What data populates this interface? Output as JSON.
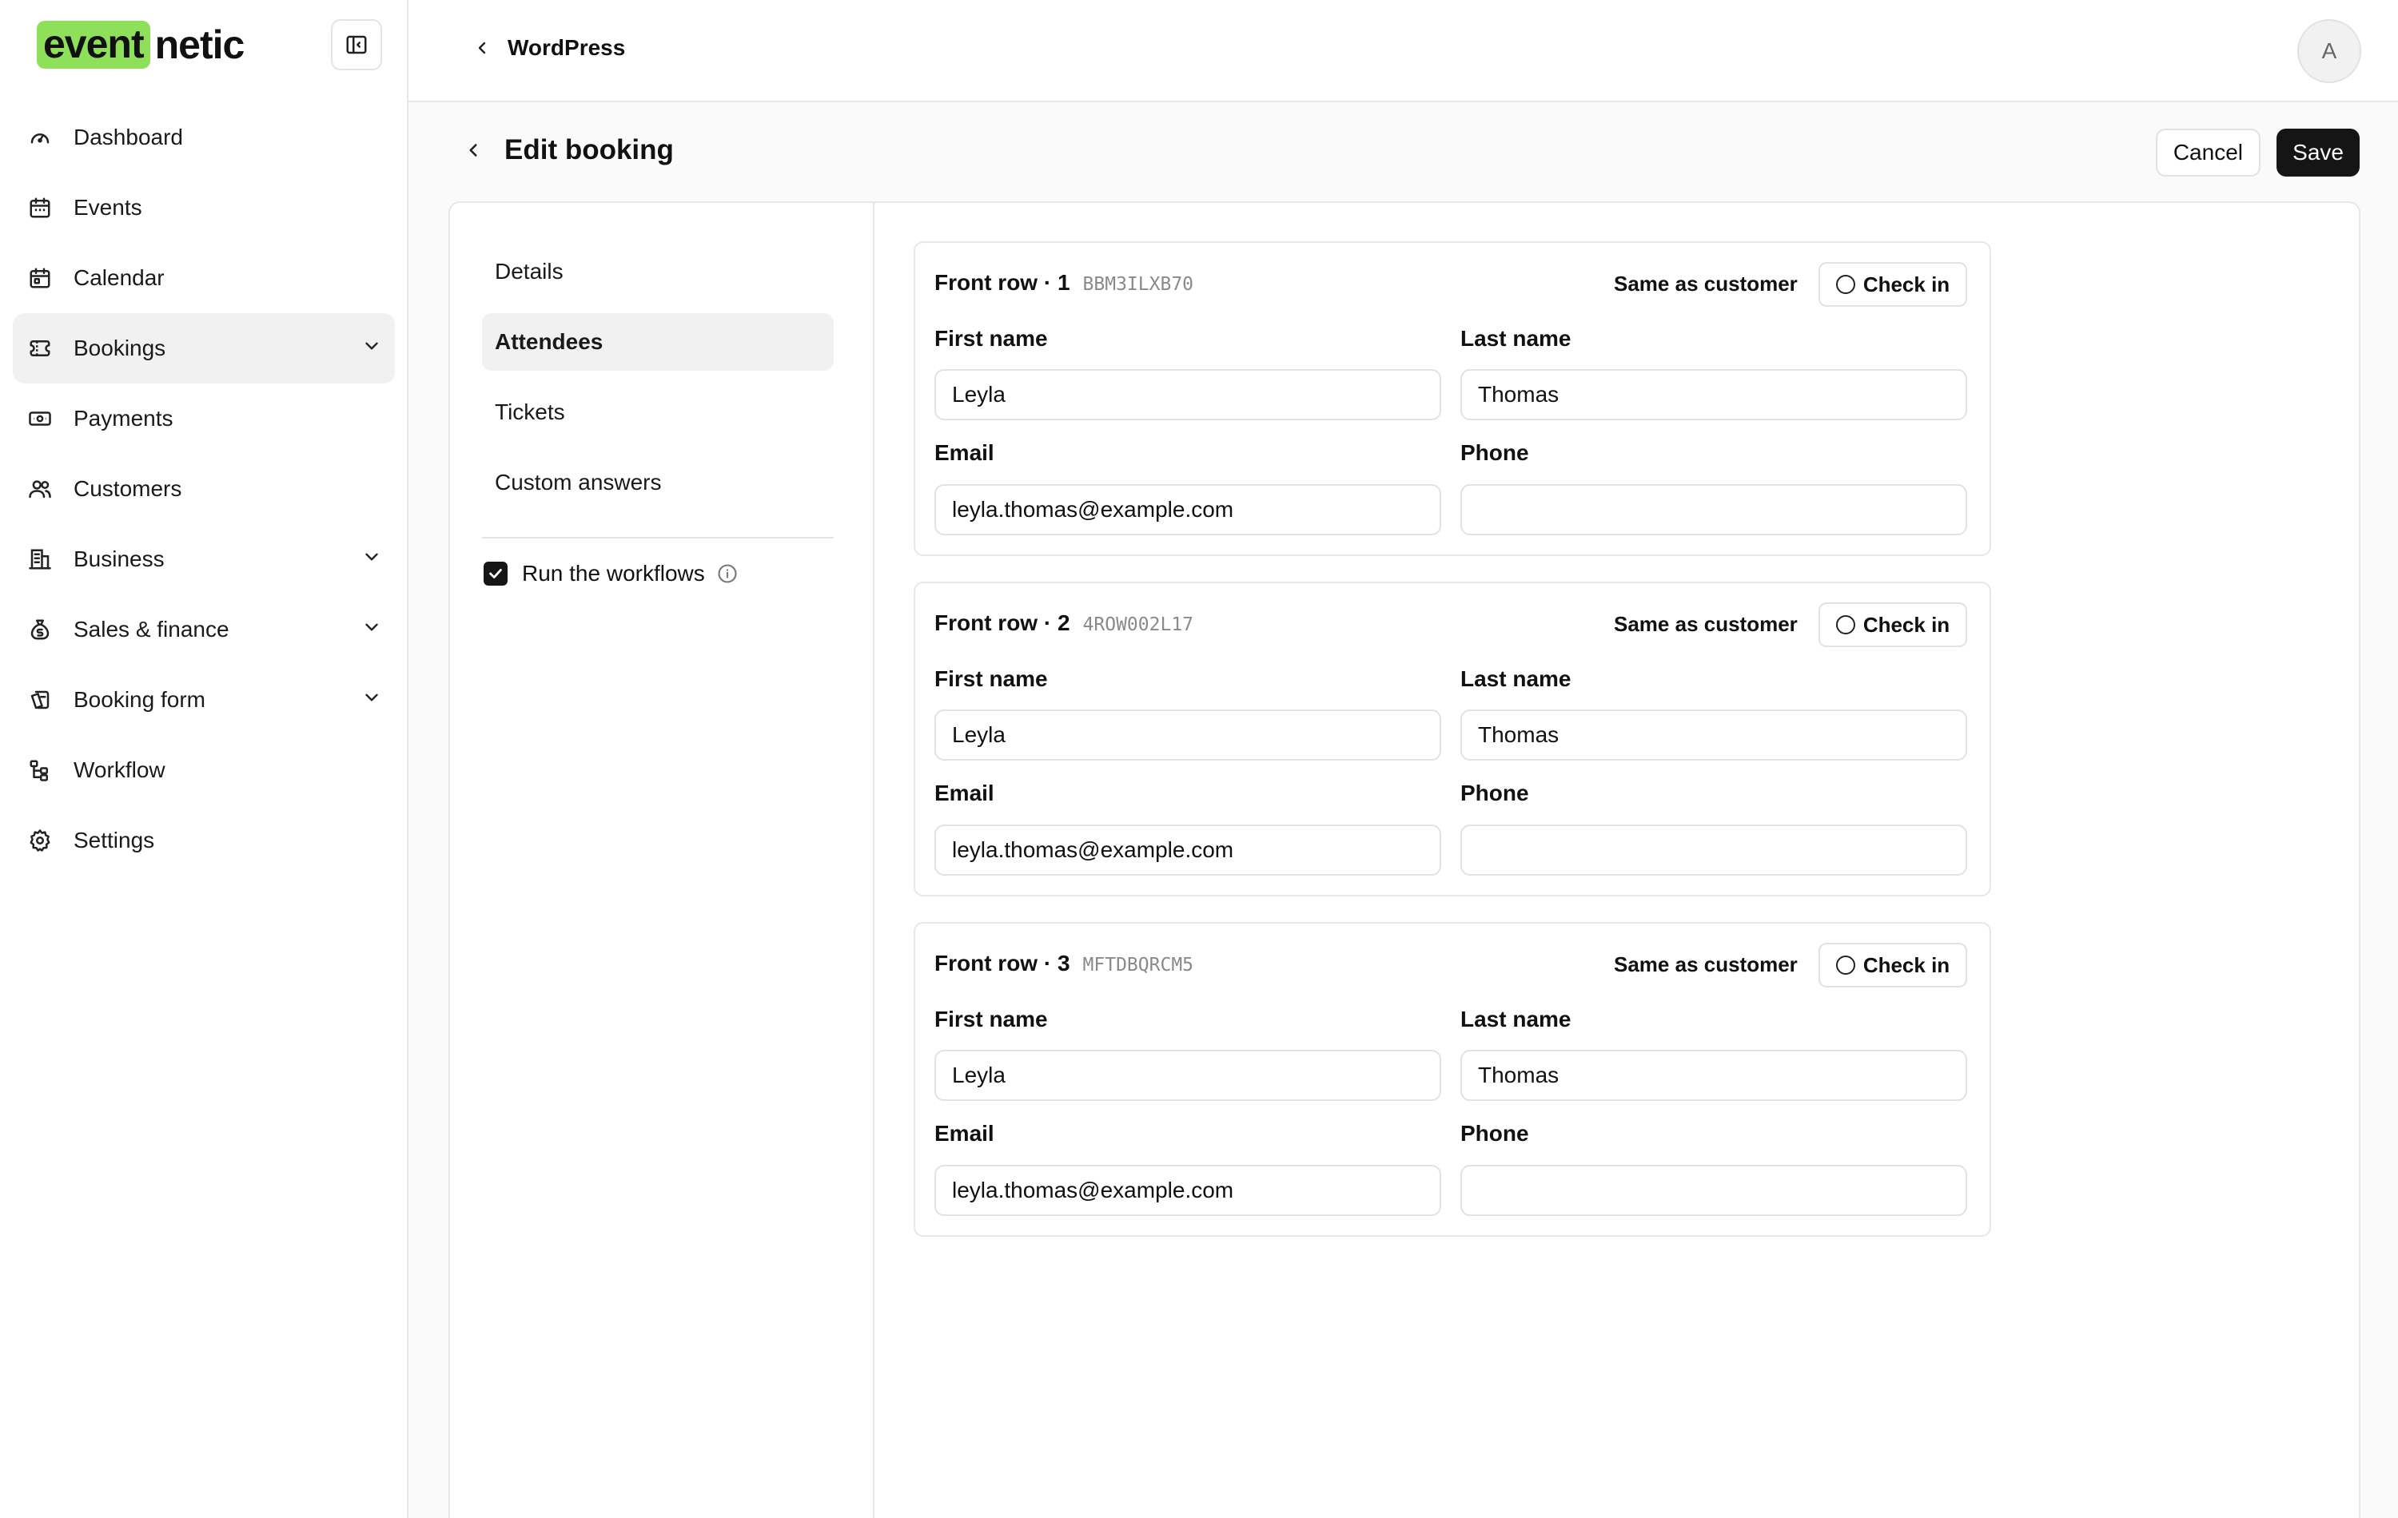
{
  "logo": {
    "part1": "event",
    "part2": "netic"
  },
  "sidebar": {
    "items": [
      {
        "label": "Dashboard",
        "icon": "gauge-icon"
      },
      {
        "label": "Events",
        "icon": "calendar-icon"
      },
      {
        "label": "Calendar",
        "icon": "calendar-icon"
      },
      {
        "label": "Bookings",
        "icon": "ticket-icon",
        "active": true,
        "expandable": true
      },
      {
        "label": "Payments",
        "icon": "banknote-icon"
      },
      {
        "label": "Customers",
        "icon": "users-icon"
      },
      {
        "label": "Business",
        "icon": "building-icon",
        "expandable": true
      },
      {
        "label": "Sales & finance",
        "icon": "money-bag-icon",
        "expandable": true
      },
      {
        "label": "Booking form",
        "icon": "form-icon",
        "expandable": true
      },
      {
        "label": "Workflow",
        "icon": "workflow-icon"
      },
      {
        "label": "Settings",
        "icon": "gear-icon"
      }
    ]
  },
  "topbar": {
    "back_label": "WordPress",
    "avatar_initial": "A"
  },
  "page": {
    "title": "Edit booking",
    "cancel_label": "Cancel",
    "save_label": "Save"
  },
  "tabs": [
    {
      "label": "Details"
    },
    {
      "label": "Attendees",
      "active": true
    },
    {
      "label": "Tickets"
    },
    {
      "label": "Custom answers"
    }
  ],
  "workflow": {
    "label": "Run the workflows",
    "checked": true
  },
  "labels": {
    "first_name": "First name",
    "last_name": "Last name",
    "email": "Email",
    "phone": "Phone",
    "same_as_customer": "Same as customer",
    "check_in": "Check in"
  },
  "attendees": [
    {
      "title": "Front row · 1",
      "code": "BBM3ILXB70",
      "first_name": "Leyla",
      "last_name": "Thomas",
      "email": "leyla.thomas@example.com",
      "phone": ""
    },
    {
      "title": "Front row · 2",
      "code": "4ROW002L17",
      "first_name": "Leyla",
      "last_name": "Thomas",
      "email": "leyla.thomas@example.com",
      "phone": ""
    },
    {
      "title": "Front row · 3",
      "code": "MFTDBQRCM5",
      "first_name": "Leyla",
      "last_name": "Thomas",
      "email": "leyla.thomas@example.com",
      "phone": ""
    }
  ],
  "colors": {
    "brand_highlight": "#8ee05a",
    "primary_button": "#151515"
  }
}
